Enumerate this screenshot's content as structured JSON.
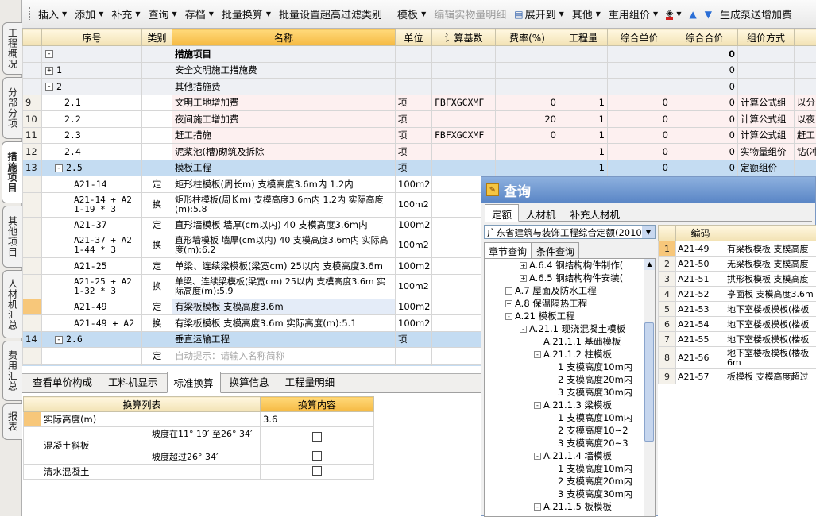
{
  "sidebar": {
    "tabs": [
      {
        "label": "工程概况",
        "active": false
      },
      {
        "label": "分部分项",
        "active": false
      },
      {
        "label": "措施项目",
        "active": true
      },
      {
        "label": "其他项目",
        "active": false
      },
      {
        "label": "人材机汇总",
        "active": false
      },
      {
        "label": "费用汇总",
        "active": false
      },
      {
        "label": "报表",
        "active": false
      }
    ]
  },
  "toolbar": {
    "insert": "插入",
    "add": "添加",
    "supplement": "补充",
    "query": "查询",
    "archive": "存档",
    "batch_convert": "批量换算",
    "batch_filter": "批量设置超高过滤类别",
    "template": "模板",
    "edit_detail": "编辑实物量明细",
    "expand_to": "展开到",
    "other": "其他",
    "reuse_price": "重用组价",
    "generate_pump": "生成泵送增加费"
  },
  "grid": {
    "headers": [
      "序号",
      "类别",
      "名称",
      "单位",
      "计算基数",
      "费率(%)",
      "工程量",
      "综合单价",
      "综合合价",
      "组价方式",
      ""
    ],
    "rows": [
      {
        "rn": "",
        "seq": "",
        "cat": "",
        "name": "措施项目",
        "unit": "",
        "base": "",
        "rate": "",
        "qty": "",
        "price": "",
        "total": "0",
        "method": "",
        "extra": ""
      },
      {
        "rn": "",
        "seq": "1",
        "cat": "",
        "name": "安全文明施工措施费",
        "unit": "",
        "base": "",
        "rate": "",
        "qty": "",
        "price": "",
        "total": "0",
        "method": "",
        "extra": ""
      },
      {
        "rn": "",
        "seq": "2",
        "cat": "",
        "name": "其他措施费",
        "unit": "",
        "base": "",
        "rate": "",
        "qty": "",
        "price": "",
        "total": "0",
        "method": "",
        "extra": ""
      },
      {
        "rn": "9",
        "seq": "2.1",
        "cat": "",
        "name": "文明工地增加费",
        "unit": "项",
        "base": "FBFXGCXMF",
        "rate": "0",
        "qty": "1",
        "price": "0",
        "total": "0",
        "method": "计算公式组",
        "extra": "以分"
      },
      {
        "rn": "10",
        "seq": "2.2",
        "cat": "",
        "name": "夜间施工增加费",
        "unit": "项",
        "base": "",
        "rate": "20",
        "qty": "1",
        "price": "0",
        "total": "0",
        "method": "计算公式组",
        "extra": "以夜"
      },
      {
        "rn": "11",
        "seq": "2.3",
        "cat": "",
        "name": "赶工措施",
        "unit": "项",
        "base": "FBFXGCXMF",
        "rate": "0",
        "qty": "1",
        "price": "0",
        "total": "0",
        "method": "计算公式组",
        "extra": "赶工"
      },
      {
        "rn": "12",
        "seq": "2.4",
        "cat": "",
        "name": "泥浆池(槽)砌筑及拆除",
        "unit": "项",
        "base": "",
        "rate": "",
        "qty": "1",
        "price": "0",
        "total": "0",
        "method": "实物量组价",
        "extra": "钻(冲"
      },
      {
        "rn": "13",
        "seq": "2.5",
        "cat": "",
        "name": "模板工程",
        "unit": "项",
        "base": "",
        "rate": "",
        "qty": "1",
        "price": "0",
        "total": "0",
        "method": "定额组价",
        "extra": ""
      },
      {
        "rn": "",
        "seq": "A21-14",
        "cat": "定",
        "name": "矩形柱模板(周长m) 支模高度3.6m内 1.2内",
        "unit": "100m2",
        "base": "",
        "rate": "",
        "qty": "",
        "price": "",
        "total": "",
        "method": "",
        "extra": ""
      },
      {
        "rn": "",
        "seq": "A21-14 + A2\n1-19 * 3",
        "cat": "换",
        "name": "矩形柱模板(周长m) 支模高度3.6m内 1.2内 实际高度(m):5.8",
        "unit": "100m2",
        "base": "",
        "rate": "",
        "qty": "",
        "price": "",
        "total": "",
        "method": "",
        "extra": ""
      },
      {
        "rn": "",
        "seq": "A21-37",
        "cat": "定",
        "name": "直形墙模板 墙厚(cm以内) 40 支模高度3.6m内",
        "unit": "100m2",
        "base": "",
        "rate": "",
        "qty": "",
        "price": "",
        "total": "",
        "method": "",
        "extra": ""
      },
      {
        "rn": "",
        "seq": "A21-37 + A2\n1-44 * 3",
        "cat": "换",
        "name": "直形墙模板 墙厚(cm以内) 40 支模高度3.6m内 实际高度(m):6.2",
        "unit": "100m2",
        "base": "",
        "rate": "",
        "qty": "",
        "price": "",
        "total": "",
        "method": "",
        "extra": ""
      },
      {
        "rn": "",
        "seq": "A21-25",
        "cat": "定",
        "name": "单梁、连续梁模板(梁宽cm) 25以内 支模高度3.6m",
        "unit": "100m2",
        "base": "",
        "rate": "",
        "qty": "",
        "price": "",
        "total": "",
        "method": "",
        "extra": ""
      },
      {
        "rn": "",
        "seq": "A21-25 + A2\n1-32 * 3",
        "cat": "换",
        "name": "单梁、连续梁模板(梁宽cm) 25以内 支模高度3.6m 实际高度(m):5.9",
        "unit": "100m2",
        "base": "",
        "rate": "",
        "qty": "",
        "price": "",
        "total": "",
        "method": "",
        "extra": ""
      },
      {
        "rn": "",
        "seq": "A21-49",
        "cat": "定",
        "name": "有梁板模板 支模高度3.6m",
        "unit": "100m2",
        "base": "",
        "rate": "",
        "qty": "",
        "price": "",
        "total": "",
        "method": "",
        "extra": ""
      },
      {
        "rn": "",
        "seq": "A21-49 + A2",
        "cat": "换",
        "name": "有梁板模板 支模高度3.6m 实际高度(m):5.1",
        "unit": "100m2",
        "base": "",
        "rate": "",
        "qty": "",
        "price": "",
        "total": "",
        "method": "",
        "extra": ""
      },
      {
        "rn": "14",
        "seq": "2.6",
        "cat": "",
        "name": "垂直运输工程",
        "unit": "项",
        "base": "",
        "rate": "",
        "qty": "",
        "price": "",
        "total": "",
        "method": "",
        "extra": ""
      },
      {
        "rn": "",
        "seq": "",
        "cat": "定",
        "name": "自动提示：请输入名称简称",
        "unit": "",
        "base": "",
        "rate": "",
        "qty": "",
        "price": "",
        "total": "",
        "method": "",
        "extra": ""
      },
      {
        "rn": "15",
        "seq": "2.7",
        "cat": "",
        "name": "材料二次运输",
        "unit": "项",
        "base": "",
        "rate": "",
        "qty": "",
        "price": "",
        "total": "",
        "method": "",
        "extra": ""
      }
    ]
  },
  "bottom": {
    "tabs": [
      "查看单价构成",
      "工料机显示",
      "标准换算",
      "换算信息",
      "工程量明细"
    ],
    "active_tab": "标准换算",
    "table_headers": [
      "换算列表",
      "换算内容"
    ],
    "rows": {
      "actual_height_label": "实际高度(m)",
      "actual_height_value": "3.6",
      "slope_group_label": "混凝土斜板",
      "slope1_label": "坡度在11° 19′ 至26° 34′",
      "slope2_label": "坡度超过26° 34′",
      "clear_concrete_label": "清水混凝土"
    }
  },
  "dialog": {
    "title": "查询",
    "tabs": [
      "定额",
      "人材机",
      "补充人材机"
    ],
    "quota_book": "广东省建筑与装饰工程综合定额(2010)",
    "subtabs": [
      "章节查询",
      "条件查询"
    ],
    "tree": [
      {
        "label": "A.6.4 钢结构构件制作(",
        "level": 3,
        "toggle": "+"
      },
      {
        "label": "A.6.5 钢结构构件安装(",
        "level": 3,
        "toggle": "+"
      },
      {
        "label": "A.7 屋面及防水工程",
        "level": 2,
        "toggle": "+"
      },
      {
        "label": "A.8 保温隔热工程",
        "level": 2,
        "toggle": "+"
      },
      {
        "label": "A.21 模板工程",
        "level": 2,
        "toggle": "-"
      },
      {
        "label": "A.21.1 现浇混凝土模板",
        "level": 3,
        "toggle": "-"
      },
      {
        "label": "A.21.1.1 基础模板",
        "level": 4,
        "toggle": ""
      },
      {
        "label": "A.21.1.2 柱模板",
        "level": 4,
        "toggle": "-"
      },
      {
        "label": "1 支模高度10m内",
        "level": 5,
        "toggle": ""
      },
      {
        "label": "2 支模高度20m内",
        "level": 5,
        "toggle": ""
      },
      {
        "label": "3 支模高度30m内",
        "level": 5,
        "toggle": ""
      },
      {
        "label": "A.21.1.3 梁模板",
        "level": 4,
        "toggle": "-"
      },
      {
        "label": "1 支模高度10m内",
        "level": 5,
        "toggle": ""
      },
      {
        "label": "2 支模高度10~2",
        "level": 5,
        "toggle": ""
      },
      {
        "label": "3 支模高度20~3",
        "level": 5,
        "toggle": ""
      },
      {
        "label": "A.21.1.4 墙模板",
        "level": 4,
        "toggle": "-"
      },
      {
        "label": "1 支模高度10m内",
        "level": 5,
        "toggle": ""
      },
      {
        "label": "2 支模高度20m内",
        "level": 5,
        "toggle": ""
      },
      {
        "label": "3 支模高度30m内",
        "level": 5,
        "toggle": ""
      },
      {
        "label": "A.21.1.5 板模板",
        "level": 4,
        "toggle": "-"
      }
    ],
    "result_headers": [
      "",
      "编码",
      ""
    ],
    "results": [
      {
        "n": "1",
        "code": "A21-49",
        "name": "有梁板模板 支模高度"
      },
      {
        "n": "2",
        "code": "A21-50",
        "name": "无梁板模板 支模高度"
      },
      {
        "n": "3",
        "code": "A21-51",
        "name": "拱形板模板 支模高度"
      },
      {
        "n": "4",
        "code": "A21-52",
        "name": "亭面板 支模高度3.6m"
      },
      {
        "n": "5",
        "code": "A21-53",
        "name": "地下室楼板模板(楼板"
      },
      {
        "n": "6",
        "code": "A21-54",
        "name": "地下室楼板模板(楼板"
      },
      {
        "n": "7",
        "code": "A21-55",
        "name": "地下室楼板模板(楼板"
      },
      {
        "n": "8",
        "code": "A21-56",
        "name": "地下室楼板模板(楼板\n6m"
      },
      {
        "n": "9",
        "code": "A21-57",
        "name": "板模板 支模高度超过"
      }
    ]
  }
}
